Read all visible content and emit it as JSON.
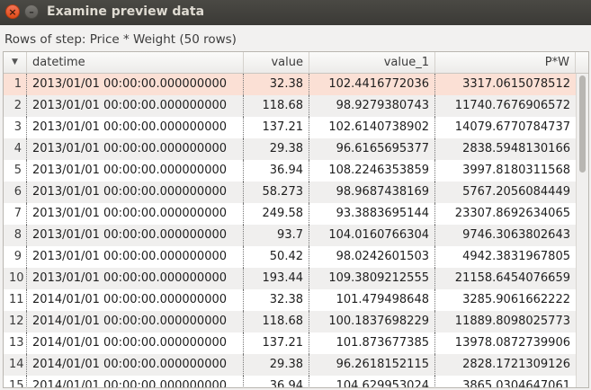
{
  "window": {
    "title": "Examine preview data",
    "close_glyph": "×",
    "minimize_glyph": "–"
  },
  "caption": "Rows of step: Price * Weight (50 rows)",
  "table": {
    "sort_glyph": "▼",
    "columns": [
      "datetime",
      "value",
      "value_1",
      "P*W"
    ],
    "rows": [
      {
        "n": "1",
        "datetime": "2013/01/01 00:00:00.000000000",
        "value": "32.38",
        "value_1": "102.4416772036",
        "pw": "3317.0615078512"
      },
      {
        "n": "2",
        "datetime": "2013/01/01 00:00:00.000000000",
        "value": "118.68",
        "value_1": "98.9279380743",
        "pw": "11740.7676906572"
      },
      {
        "n": "3",
        "datetime": "2013/01/01 00:00:00.000000000",
        "value": "137.21",
        "value_1": "102.6140738902",
        "pw": "14079.6770784737"
      },
      {
        "n": "4",
        "datetime": "2013/01/01 00:00:00.000000000",
        "value": "29.38",
        "value_1": "96.6165695377",
        "pw": "2838.5948130166"
      },
      {
        "n": "5",
        "datetime": "2013/01/01 00:00:00.000000000",
        "value": "36.94",
        "value_1": "108.2246353859",
        "pw": "3997.8180311568"
      },
      {
        "n": "6",
        "datetime": "2013/01/01 00:00:00.000000000",
        "value": "58.273",
        "value_1": "98.9687438169",
        "pw": "5767.2056084449"
      },
      {
        "n": "7",
        "datetime": "2013/01/01 00:00:00.000000000",
        "value": "249.58",
        "value_1": "93.3883695144",
        "pw": "23307.8692634065"
      },
      {
        "n": "8",
        "datetime": "2013/01/01 00:00:00.000000000",
        "value": "93.7",
        "value_1": "104.0160766304",
        "pw": "9746.3063802643"
      },
      {
        "n": "9",
        "datetime": "2013/01/01 00:00:00.000000000",
        "value": "50.42",
        "value_1": "98.0242601503",
        "pw": "4942.3831967805"
      },
      {
        "n": "10",
        "datetime": "2013/01/01 00:00:00.000000000",
        "value": "193.44",
        "value_1": "109.3809212555",
        "pw": "21158.6454076659"
      },
      {
        "n": "11",
        "datetime": "2014/01/01 00:00:00.000000000",
        "value": "32.38",
        "value_1": "101.479498648",
        "pw": "3285.9061662222"
      },
      {
        "n": "12",
        "datetime": "2014/01/01 00:00:00.000000000",
        "value": "118.68",
        "value_1": "100.1837698229",
        "pw": "11889.8098025773"
      },
      {
        "n": "13",
        "datetime": "2014/01/01 00:00:00.000000000",
        "value": "137.21",
        "value_1": "101.873677385",
        "pw": "13978.0872739906"
      },
      {
        "n": "14",
        "datetime": "2014/01/01 00:00:00.000000000",
        "value": "29.38",
        "value_1": "96.2618152115",
        "pw": "2828.1721309126"
      },
      {
        "n": "15",
        "datetime": "2014/01/01 00:00:00.000000000",
        "value": "36.94",
        "value_1": "104.629953024",
        "pw": "3865.0304647061"
      }
    ]
  }
}
